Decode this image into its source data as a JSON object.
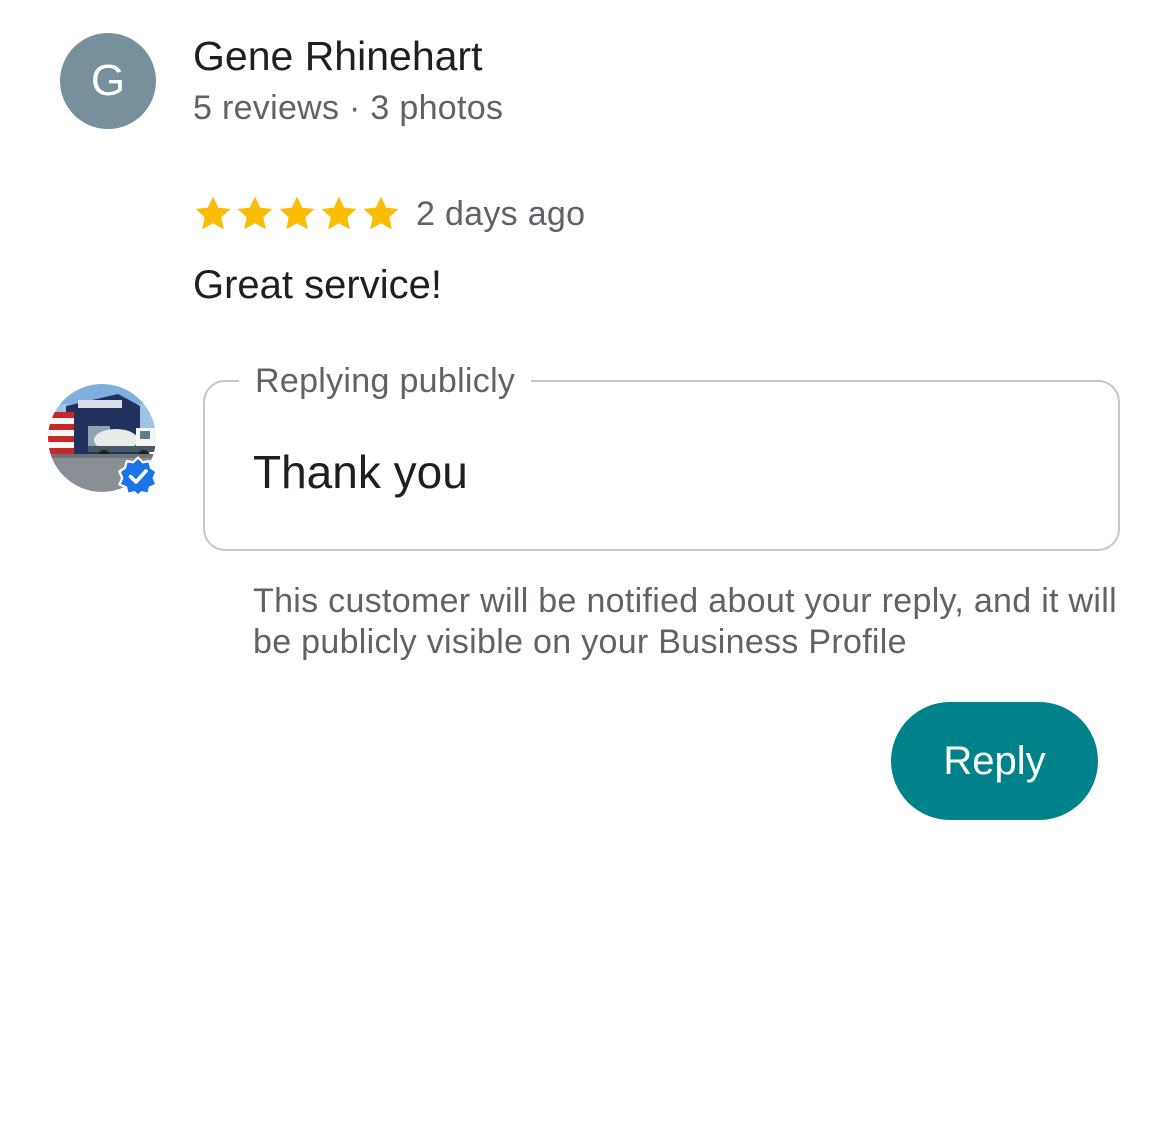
{
  "reviewer": {
    "initial": "G",
    "name": "Gene Rhinehart",
    "meta": "5 reviews · 3 photos",
    "avatar_color": "#78909c"
  },
  "review": {
    "rating": 5,
    "max_rating": 5,
    "date": "2 days ago",
    "text": "Great service!",
    "star_color": "#fbbc04"
  },
  "business": {
    "avatar_icon": "business-photo",
    "verified_icon": "verified-check-icon",
    "verified_color": "#1a73e8"
  },
  "reply": {
    "legend": "Replying publicly",
    "value": "Thank you",
    "note": "This customer will be notified about your reply, and it will be publicly visible on your Business Profile",
    "button_label": "Reply",
    "accent_color": "#00828a"
  }
}
